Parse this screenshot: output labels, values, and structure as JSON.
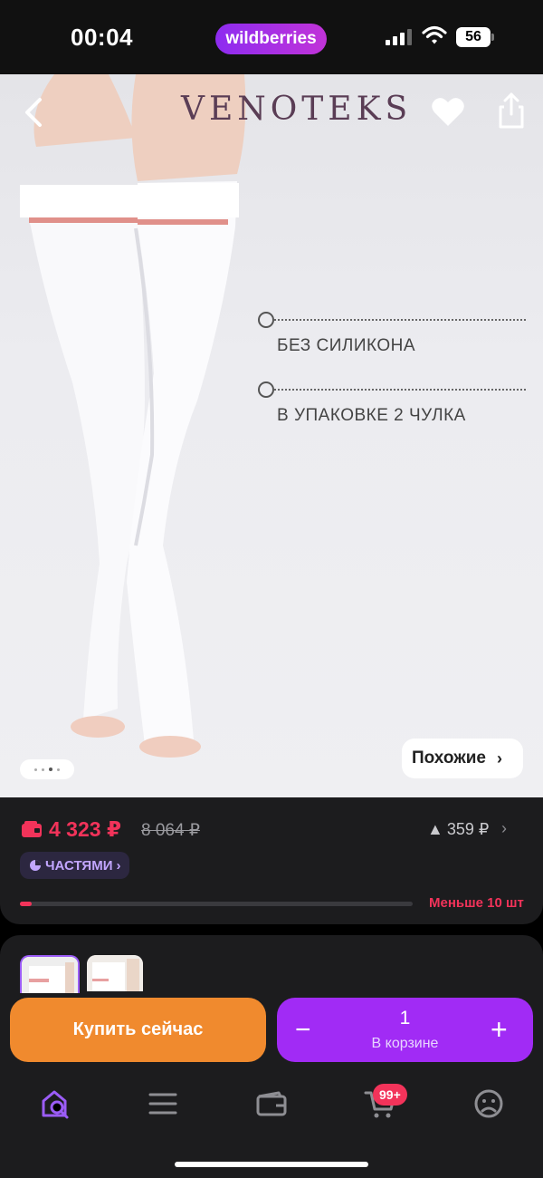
{
  "status_bar": {
    "time": "00:04",
    "app_name": "wildberries",
    "battery": "56"
  },
  "product_image": {
    "brand": "VENOTEKS",
    "features": [
      "БЕЗ СИЛИКОНА",
      "В УПАКОВКЕ 2 ЧУЛКА"
    ],
    "similar_label": "Похожие",
    "similar_chevron": "›",
    "gallery_dots": 4,
    "gallery_active": 2
  },
  "price_card": {
    "price": "4 323 ₽",
    "old_price": "8 064 ₽",
    "delta": "359 ₽",
    "delta_arrow": "▲",
    "delta_chevron": "›",
    "parts_label": "ЧАСТЯМИ",
    "parts_chevron": "›",
    "stock_label": "Меньше 10 шт",
    "stock_fraction": 0.03
  },
  "bottom_sheet": {
    "buy_now": "Купить сейчас",
    "minus": "−",
    "plus": "+",
    "quantity": "1",
    "in_cart": "В корзине"
  },
  "tab_bar": {
    "cart_badge": "99+",
    "icons": [
      "search-home-icon",
      "catalog-menu-icon",
      "wallet-icon",
      "cart-icon",
      "profile-icon"
    ]
  },
  "colors": {
    "accent": "#a12bf5",
    "buy": "#f08a2e",
    "price": "#f2335a",
    "card_bg": "#1c1c1e"
  }
}
